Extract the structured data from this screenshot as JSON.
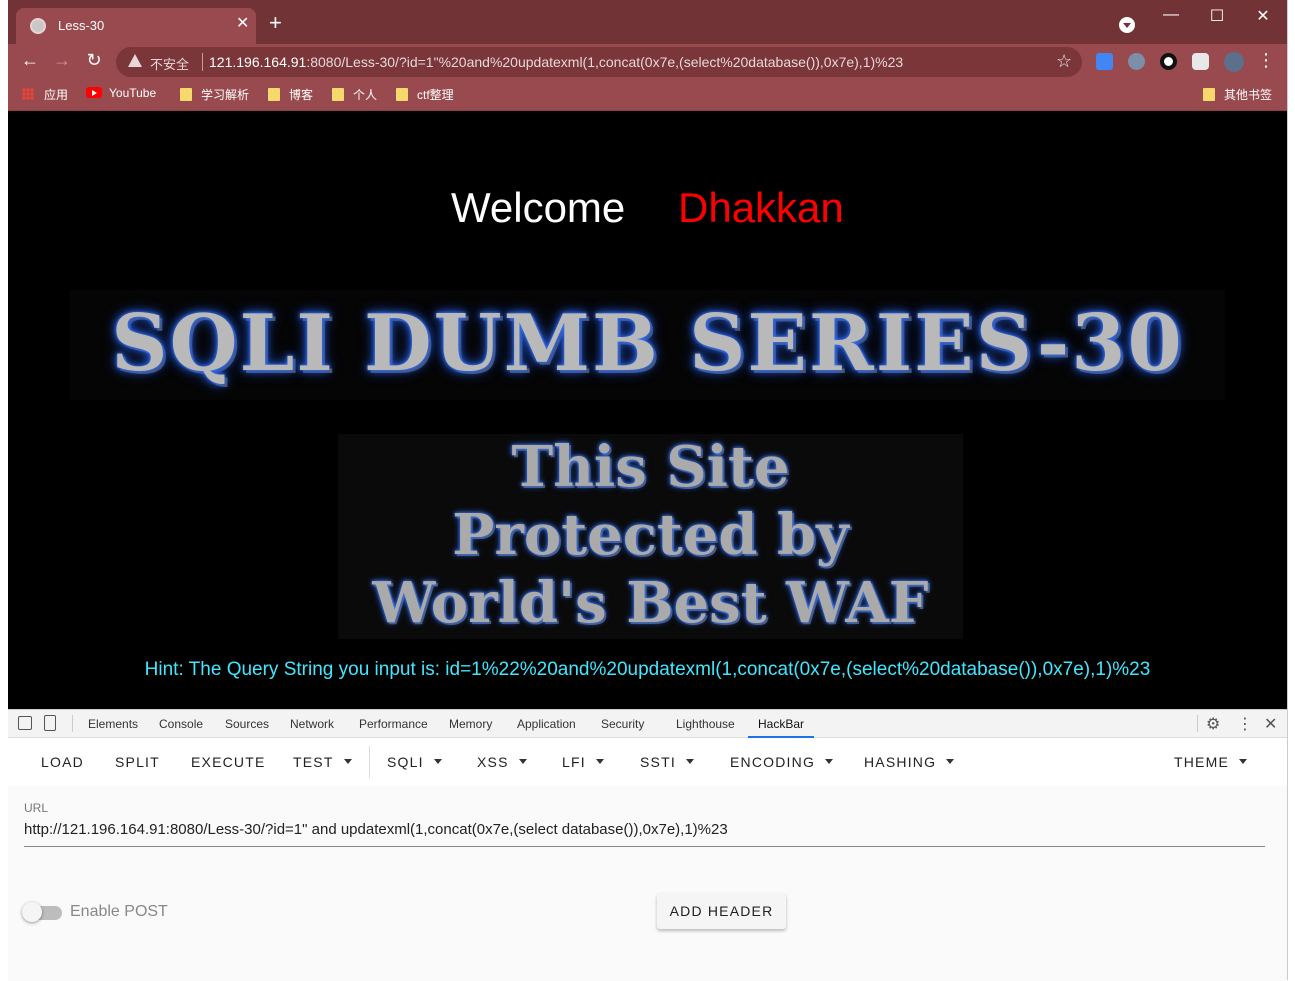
{
  "browser": {
    "tab_title": "Less-30",
    "new_tab": "+",
    "tab_close": "✕",
    "window_controls": {
      "minimize": "—",
      "maximize": "☐",
      "close": "✕"
    },
    "nav": {
      "back": "←",
      "forward": "→",
      "reload": "↻"
    },
    "omnibox": {
      "insecure_label": "不安全",
      "host": "121.196.164.91",
      "path": ":8080/Less-30/?id=1\"%20and%20updatexml(1,concat(0x7e,(select%20database()),0x7e),1)%23",
      "star": "☆"
    },
    "extensions": [
      "translate-icon",
      "owl-icon",
      "circle-icon",
      "puzzle-icon",
      "profile-avatar"
    ],
    "menu": "⋮",
    "bookmarks": [
      {
        "label": "应用",
        "icon": "apps-icon"
      },
      {
        "label": "YouTube",
        "icon": "youtube-icon"
      },
      {
        "label": "学习解析",
        "icon": "folder-icon"
      },
      {
        "label": "博客",
        "icon": "folder-icon"
      },
      {
        "label": "个人",
        "icon": "folder-icon"
      },
      {
        "label": "ctf整理",
        "icon": "folder-icon"
      }
    ],
    "other_bookmarks": "其他书签"
  },
  "page": {
    "welcome": "Welcome",
    "name": "Dhakkan",
    "banner": "SQLI DUMB SERIES-30",
    "waf_lines": [
      "This Site",
      "Protected by",
      "World's Best WAF"
    ],
    "hint": "Hint: The Query String you input is: id=1%22%20and%20updatexml(1,concat(0x7e,(select%20database()),0x7e),1)%23"
  },
  "devtools": {
    "tabs": [
      "Elements",
      "Console",
      "Sources",
      "Network",
      "Performance",
      "Memory",
      "Application",
      "Security",
      "Lighthouse",
      "HackBar"
    ],
    "active_tab": "HackBar",
    "settings": "⚙",
    "more": "⋮",
    "close": "✕"
  },
  "hackbar": {
    "menu": {
      "load": "LOAD",
      "split": "SPLIT",
      "execute": "EXECUTE",
      "test": "TEST",
      "sqli": "SQLI",
      "xss": "XSS",
      "lfi": "LFI",
      "ssti": "SSTI",
      "encoding": "ENCODING",
      "hashing": "HASHING",
      "theme": "THEME"
    },
    "url_label": "URL",
    "url_value": "http://121.196.164.91:8080/Less-30/?id=1\" and updatexml(1,concat(0x7e,(select database()),0x7e),1)%23",
    "enable_post": "Enable POST",
    "enable_post_on": false,
    "add_header": "ADD HEADER"
  },
  "colors": {
    "titlebar": "#723336",
    "toolbar": "#994a4e",
    "hint": "#42e6ff",
    "name": "#ff0000",
    "accent": "#1a73e8"
  }
}
